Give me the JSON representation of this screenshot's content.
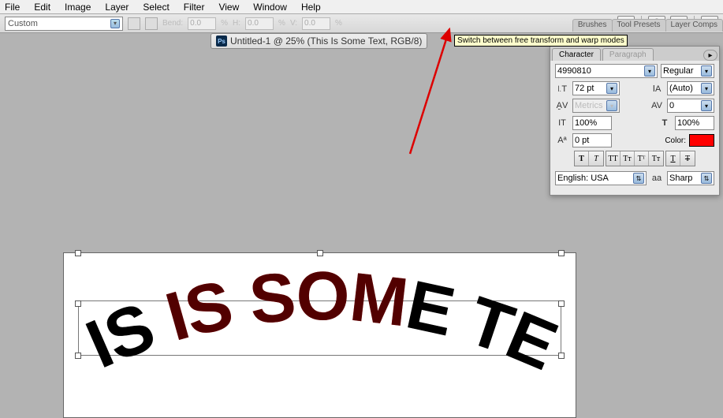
{
  "menu": {
    "items": [
      "File",
      "Edit",
      "Image",
      "Layer",
      "Select",
      "Filter",
      "View",
      "Window",
      "Help"
    ]
  },
  "options": {
    "warp_style": "Custom",
    "bend_label": "Bend:",
    "bend_val": "0.0",
    "h_label": "H:",
    "h_val": "0.0",
    "v_label": "V:",
    "v_val": "0.0",
    "pct": "%"
  },
  "panel_tabs": [
    "Brushes",
    "Tool Presets",
    "Layer Comps"
  ],
  "doc": {
    "title": "Untitled-1 @ 25% (This Is Some Text, RGB/8)"
  },
  "tooltip": "Switch between free transform and warp modes",
  "char": {
    "tab_char": "Character",
    "tab_para": "Paragraph",
    "font": "4990810",
    "style": "Regular",
    "size": "72 pt",
    "leading": "(Auto)",
    "kerning": "Metrics",
    "tracking": "0",
    "vscale": "100%",
    "hscale": "100%",
    "baseline": "0 pt",
    "color_label": "Color:",
    "lang": "English: USA",
    "aa_prefix": "aa",
    "aa": "Sharp",
    "styles": {
      "bold": "T",
      "italic": "T",
      "caps": "TT",
      "small": "Tᴛ",
      "super": "Tᵀ",
      "sub": "Tᴛ",
      "under": "T",
      "strike": "T"
    }
  },
  "canvas_text": "THIS IS SOME TEXT"
}
